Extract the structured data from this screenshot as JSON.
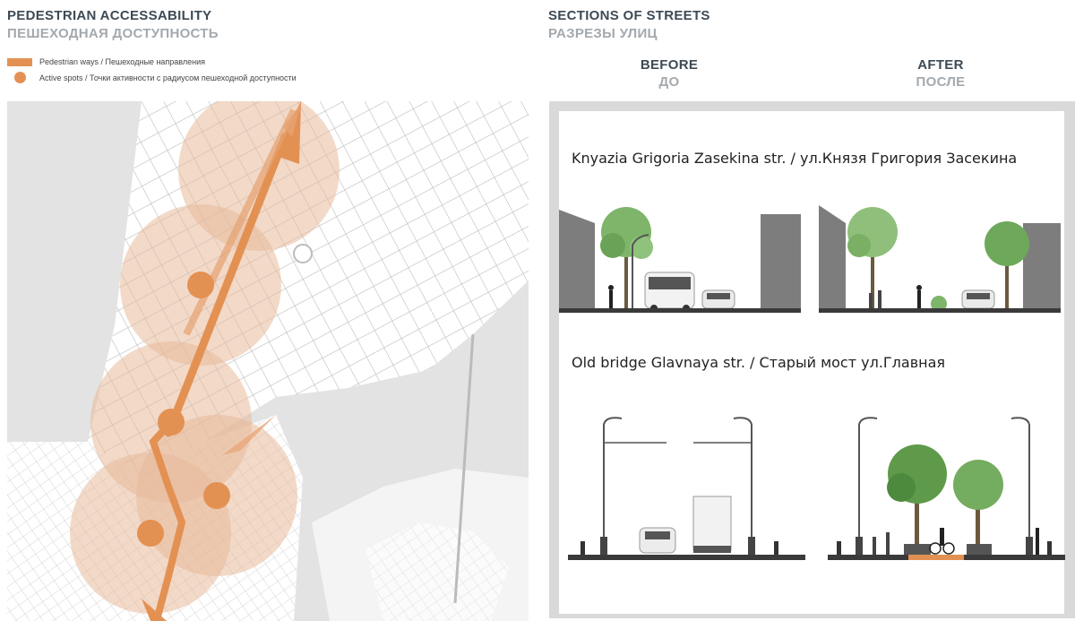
{
  "left": {
    "title_en": "PEDESTRIAN ACCESSABILITY",
    "title_ru": "ПЕШЕХОДНАЯ ДОСТУПНОСТЬ",
    "legend": [
      {
        "label": "Pedestrian ways / Пешеходные направления",
        "icon": "orange-bar-icon"
      },
      {
        "label": "Active spots / Точки активности с радиусом пешеходной доступности",
        "icon": "orange-dot-icon"
      }
    ]
  },
  "right": {
    "title_en": "SECTIONS OF STREETS",
    "title_ru": "РАЗРЕЗЫ УЛИЦ",
    "before_en": "BEFORE",
    "before_ru": "ДО",
    "after_en": "AFTER",
    "after_ru": "ПОСЛЕ",
    "streets": [
      {
        "title": "Knyazia Grigoria Zasekina str. / ул.Князя Григория Засекина"
      },
      {
        "title": "Old bridge Glavnaya str. / Старый мост ул.Главная"
      }
    ]
  },
  "colors": {
    "accent": "#e39153",
    "circle": "#e8b99a",
    "title_dark": "#3d4a55",
    "title_light": "#a3a9ae",
    "map_gray": "#e3e3e3",
    "tree": "#5e9a4a",
    "road": "#3a3a3a"
  }
}
